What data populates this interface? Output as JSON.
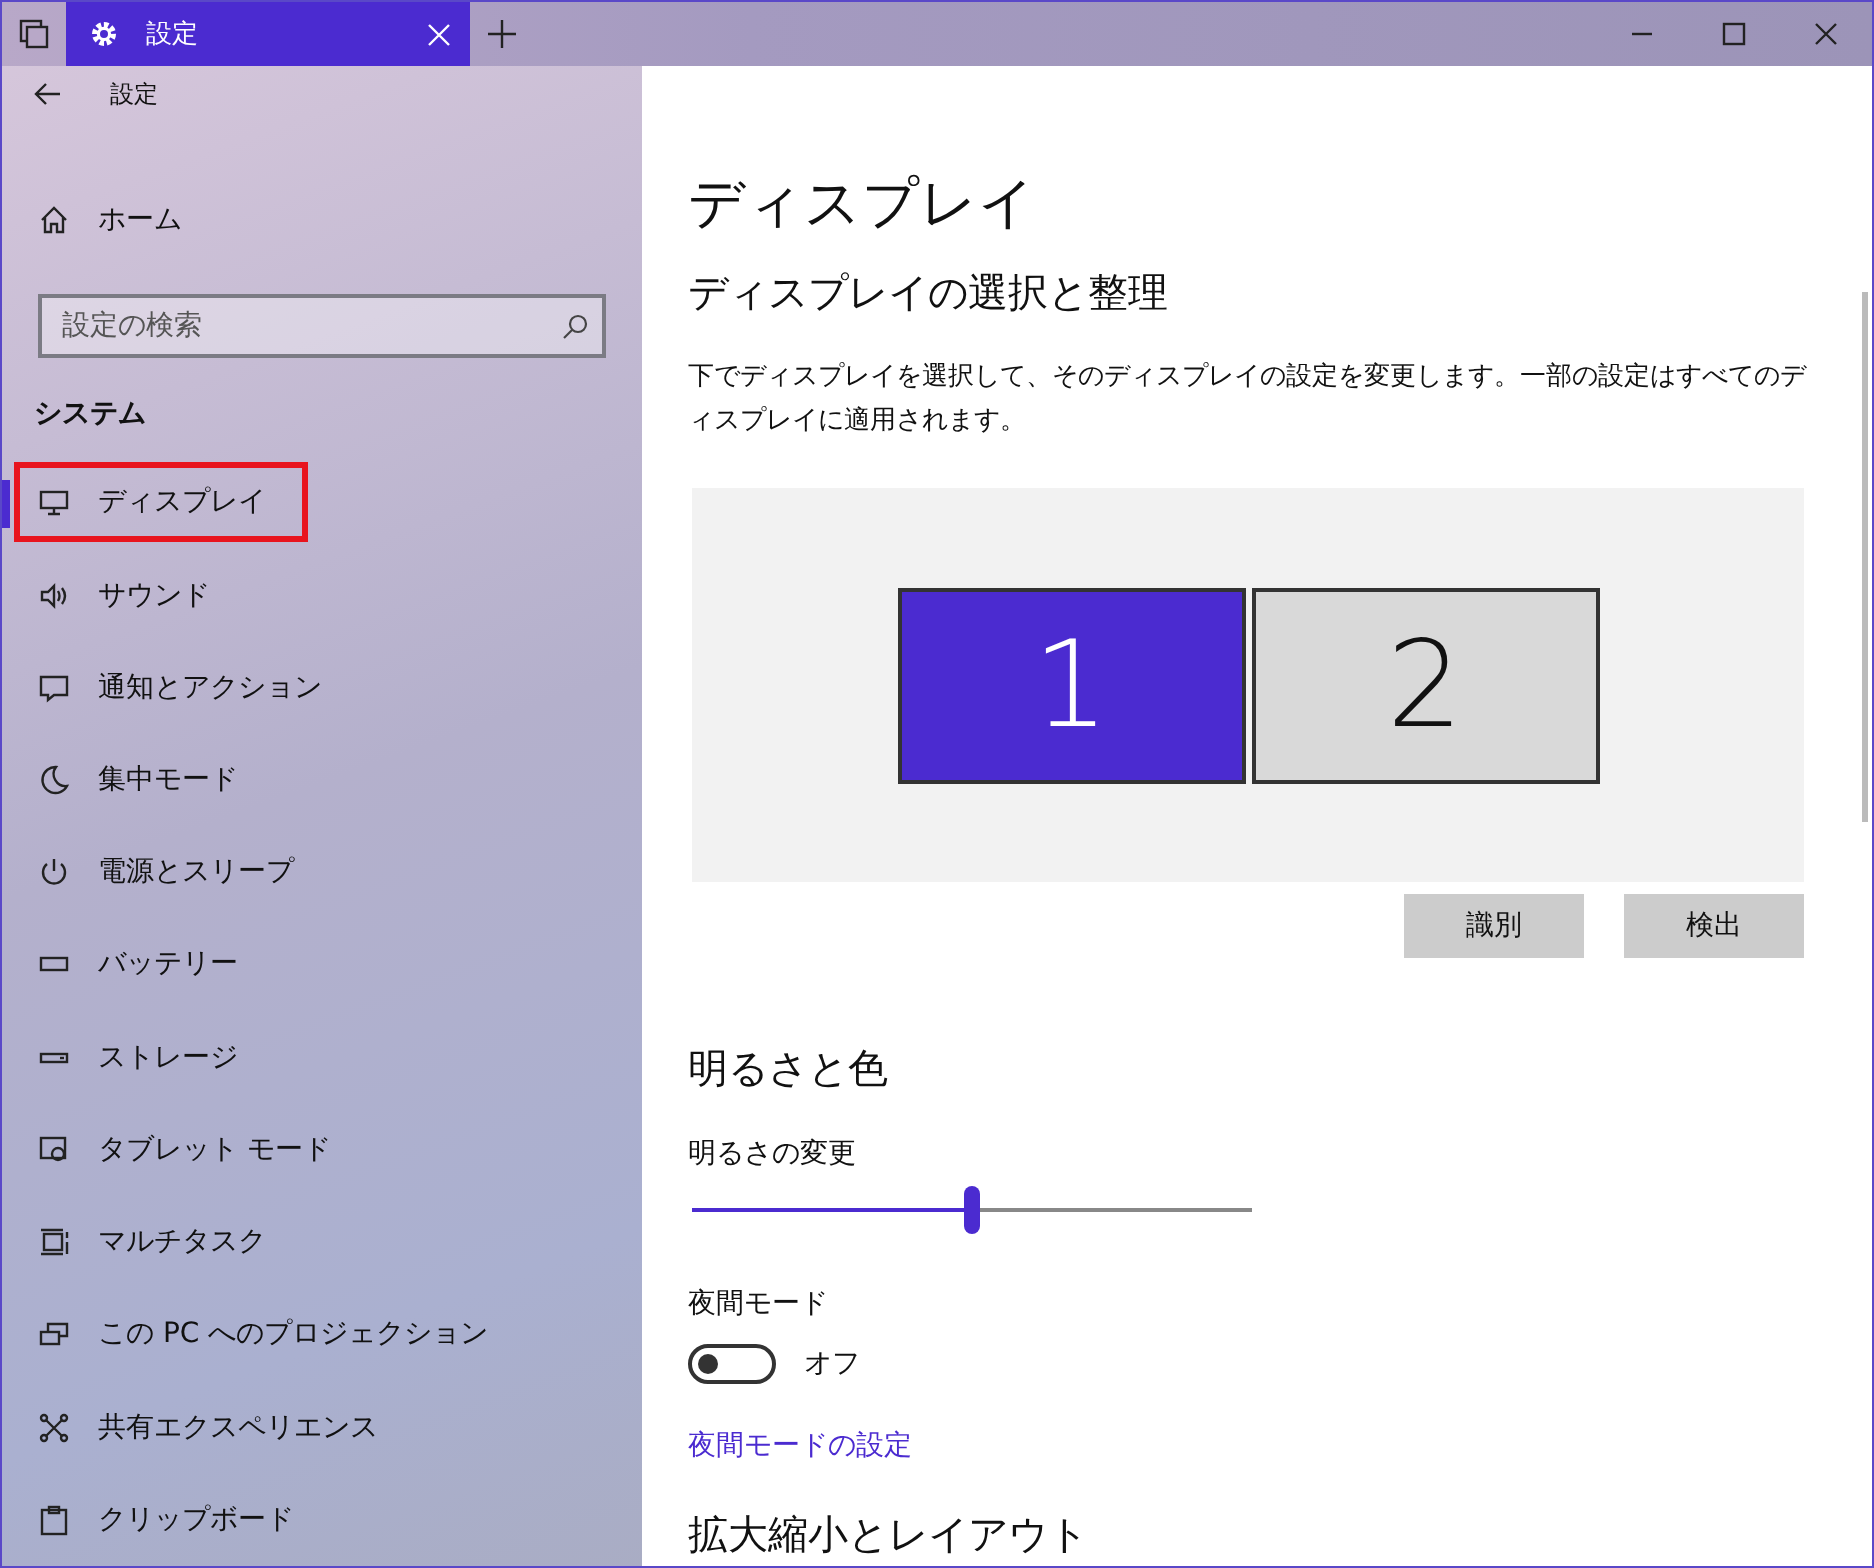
{
  "window": {
    "tab_title": "設定"
  },
  "sidebar": {
    "back_title": "設定",
    "home": "ホーム",
    "search": {
      "placeholder": "設定の検索"
    },
    "section": "システム",
    "items": [
      {
        "label": "ディスプレイ",
        "selected": true,
        "annotated": true
      },
      {
        "label": "サウンド",
        "selected": false,
        "annotated": false
      },
      {
        "label": "通知とアクション",
        "selected": false,
        "annotated": false
      },
      {
        "label": "集中モード",
        "selected": false,
        "annotated": false
      },
      {
        "label": "電源とスリープ",
        "selected": false,
        "annotated": false
      },
      {
        "label": "バッテリー",
        "selected": false,
        "annotated": false
      },
      {
        "label": "ストレージ",
        "selected": false,
        "annotated": false
      },
      {
        "label": "タブレット モード",
        "selected": false,
        "annotated": false
      },
      {
        "label": "マルチタスク",
        "selected": false,
        "annotated": false
      },
      {
        "label": "この PC へのプロジェクション",
        "selected": false,
        "annotated": false
      },
      {
        "label": "共有エクスペリエンス",
        "selected": false,
        "annotated": false
      },
      {
        "label": "クリップボード",
        "selected": false,
        "annotated": false
      }
    ]
  },
  "content": {
    "title": "ディスプレイ",
    "arrange_heading": "ディスプレイの選択と整理",
    "description": "下でディスプレイを選択して、そのディスプレイの設定を変更します。一部の設定はすべてのディスプレイに適用されます。",
    "monitors": [
      {
        "label": "1",
        "selected": true
      },
      {
        "label": "2",
        "selected": false
      }
    ],
    "buttons": [
      "識別",
      "検出"
    ],
    "brightness_heading": "明るさと色",
    "brightness_label": "明るさの変更",
    "brightness": {
      "level": 0.5
    },
    "night_mode": {
      "label": "夜間モード",
      "on": false,
      "state_text": "オフ"
    },
    "night_link": "夜間モードの設定",
    "scale_heading": "拡大縮小とレイアウト"
  }
}
